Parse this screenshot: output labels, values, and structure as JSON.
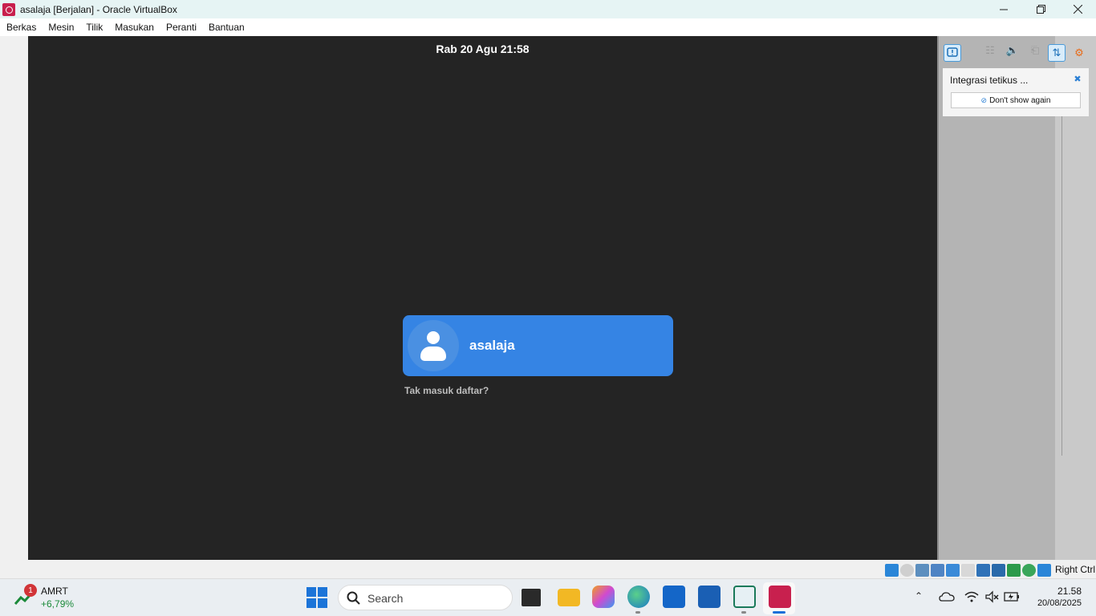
{
  "window": {
    "title": "asalaja [Berjalan] - Oracle VirtualBox",
    "icon": "virtualbox-icon",
    "controls": [
      "minimize-icon",
      "restore-icon",
      "close-icon"
    ]
  },
  "menubar": {
    "items": [
      "Berkas",
      "Mesin",
      "Tilik",
      "Masukan",
      "Peranti",
      "Bantuan"
    ]
  },
  "vm": {
    "clock": "Rab 20 Agu  21:58",
    "username": "asalaja",
    "not_listed": "Tak masuk daftar?",
    "colors": {
      "background": "#242424",
      "card": "#3584e4"
    }
  },
  "notification": {
    "title": "Integrasi tetikus ...",
    "button": "Don't show again"
  },
  "status_bar": {
    "host_key": "Right Ctrl"
  },
  "taskbar": {
    "stock_name": "AMRT",
    "stock_change": "+6,79%",
    "stock_badge": "1",
    "search_placeholder": "Search",
    "time": "21.58",
    "date": "20/08/2025"
  }
}
